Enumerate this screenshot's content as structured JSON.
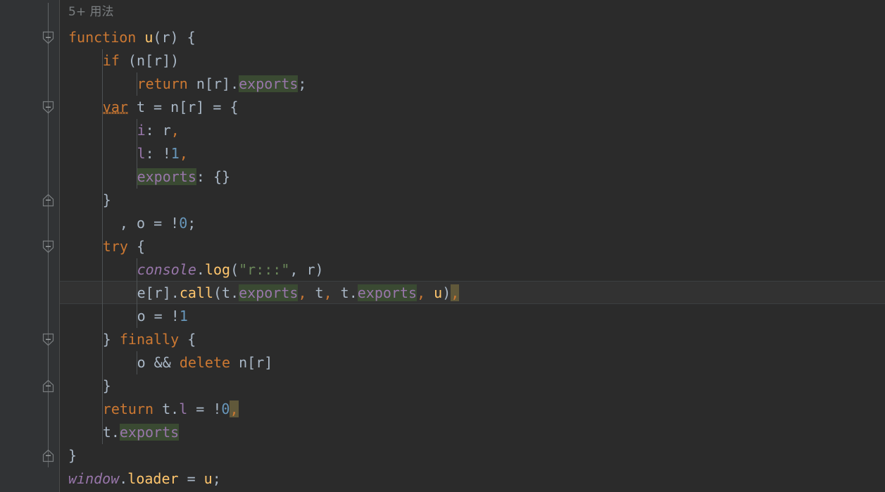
{
  "window": {
    "theme": "darcula",
    "background": "#2b2b2b",
    "gutter_background": "#313335",
    "current_line_background": "#323232",
    "accent": "#4a88c7",
    "search_highlight": "#3a4a32",
    "brace_highlight": "#60583a",
    "default_text": "#a9b7c6"
  },
  "tab_indicator": {
    "name": "active-tab-underline",
    "color": "#4a88c7"
  },
  "code_vision": {
    "label": "5+ 用法"
  },
  "gutter": {
    "fold_markers": [
      {
        "type": "expanded-down",
        "line": 1
      },
      {
        "type": "expanded-down",
        "line": 4
      },
      {
        "type": "expanded-up",
        "line": 8
      },
      {
        "type": "expanded-down",
        "line": 10
      },
      {
        "type": "expanded-down",
        "line": 14
      },
      {
        "type": "expanded-up",
        "line": 16
      },
      {
        "type": "expanded-up",
        "line": 19
      }
    ]
  },
  "editor": {
    "current_line_index": 12,
    "lines": [
      {
        "n": 0,
        "indent": 0,
        "kind": "inline-hint",
        "text": "5+ 用法"
      },
      {
        "n": 1,
        "indent": 0,
        "tokens": [
          {
            "t": "function",
            "c": "kw"
          },
          {
            "t": " ",
            "c": "plain"
          },
          {
            "t": "u",
            "c": "fnname"
          },
          {
            "t": "(",
            "c": "punct"
          },
          {
            "t": "r",
            "c": "ident"
          },
          {
            "t": ") {",
            "c": "punct"
          }
        ]
      },
      {
        "n": 2,
        "indent": 1,
        "tokens": [
          {
            "t": "if",
            "c": "kw"
          },
          {
            "t": " (",
            "c": "punct"
          },
          {
            "t": "n",
            "c": "ident"
          },
          {
            "t": "[",
            "c": "punct"
          },
          {
            "t": "r",
            "c": "ident"
          },
          {
            "t": "])",
            "c": "punct"
          }
        ]
      },
      {
        "n": 3,
        "indent": 2,
        "tokens": [
          {
            "t": "return",
            "c": "kw"
          },
          {
            "t": " ",
            "c": "plain"
          },
          {
            "t": "n",
            "c": "ident"
          },
          {
            "t": "[",
            "c": "punct"
          },
          {
            "t": "r",
            "c": "ident"
          },
          {
            "t": "].",
            "c": "punct"
          },
          {
            "t": "exports",
            "c": "prop",
            "hl": "search"
          },
          {
            "t": ";",
            "c": "punct"
          }
        ]
      },
      {
        "n": 4,
        "indent": 1,
        "tokens": [
          {
            "t": "var",
            "c": "kw",
            "squiggle": true
          },
          {
            "t": " ",
            "c": "plain"
          },
          {
            "t": "t",
            "c": "ident"
          },
          {
            "t": " = ",
            "c": "punct"
          },
          {
            "t": "n",
            "c": "ident"
          },
          {
            "t": "[",
            "c": "punct"
          },
          {
            "t": "r",
            "c": "ident"
          },
          {
            "t": "] = {",
            "c": "punct"
          }
        ]
      },
      {
        "n": 5,
        "indent": 2,
        "tokens": [
          {
            "t": "i",
            "c": "field"
          },
          {
            "t": ": ",
            "c": "punct"
          },
          {
            "t": "r",
            "c": "ident"
          },
          {
            "t": ",",
            "c": "comma"
          }
        ]
      },
      {
        "n": 6,
        "indent": 2,
        "tokens": [
          {
            "t": "l",
            "c": "field"
          },
          {
            "t": ": ",
            "c": "punct"
          },
          {
            "t": "!",
            "c": "punct"
          },
          {
            "t": "1",
            "c": "num"
          },
          {
            "t": ",",
            "c": "comma"
          }
        ]
      },
      {
        "n": 7,
        "indent": 2,
        "tokens": [
          {
            "t": "exports",
            "c": "prop",
            "hl": "search"
          },
          {
            "t": ": {}",
            "c": "punct"
          }
        ]
      },
      {
        "n": 8,
        "indent": 1,
        "tokens": [
          {
            "t": "}",
            "c": "punct"
          }
        ]
      },
      {
        "n": 9,
        "indent": 1,
        "lead": "  ",
        "tokens": [
          {
            "t": ", ",
            "c": "punct"
          },
          {
            "t": "o",
            "c": "ident"
          },
          {
            "t": " = ",
            "c": "punct"
          },
          {
            "t": "!",
            "c": "punct"
          },
          {
            "t": "0",
            "c": "num"
          },
          {
            "t": ";",
            "c": "punct"
          }
        ]
      },
      {
        "n": 10,
        "indent": 1,
        "tokens": [
          {
            "t": "try",
            "c": "kw"
          },
          {
            "t": " {",
            "c": "punct"
          }
        ]
      },
      {
        "n": 11,
        "indent": 2,
        "tokens": [
          {
            "t": "console",
            "c": "global"
          },
          {
            "t": ".",
            "c": "punct"
          },
          {
            "t": "log",
            "c": "fnname"
          },
          {
            "t": "(",
            "c": "punct"
          },
          {
            "t": "\"r:::\"",
            "c": "str"
          },
          {
            "t": ", ",
            "c": "punct"
          },
          {
            "t": "r",
            "c": "ident"
          },
          {
            "t": ")",
            "c": "punct"
          }
        ]
      },
      {
        "n": 12,
        "indent": 2,
        "current": true,
        "tokens": [
          {
            "t": "e",
            "c": "ident"
          },
          {
            "t": "[",
            "c": "punct"
          },
          {
            "t": "r",
            "c": "ident"
          },
          {
            "t": "].",
            "c": "punct"
          },
          {
            "t": "call",
            "c": "fnname"
          },
          {
            "t": "(",
            "c": "punct"
          },
          {
            "t": "t",
            "c": "ident"
          },
          {
            "t": ".",
            "c": "punct"
          },
          {
            "t": "exports",
            "c": "prop",
            "hl": "search"
          },
          {
            "t": ",",
            "c": "comma"
          },
          {
            "t": " ",
            "c": "plain"
          },
          {
            "t": "t",
            "c": "ident"
          },
          {
            "t": ",",
            "c": "comma"
          },
          {
            "t": " ",
            "c": "plain"
          },
          {
            "t": "t",
            "c": "ident"
          },
          {
            "t": ".",
            "c": "punct"
          },
          {
            "t": "exports",
            "c": "prop",
            "hl": "search"
          },
          {
            "t": ",",
            "c": "comma"
          },
          {
            "t": " ",
            "c": "plain"
          },
          {
            "t": "u",
            "c": "fnname"
          },
          {
            "t": ")",
            "c": "punct"
          },
          {
            "t": ",",
            "c": "comma",
            "hl": "brace"
          }
        ]
      },
      {
        "n": 13,
        "indent": 2,
        "tokens": [
          {
            "t": "o",
            "c": "ident"
          },
          {
            "t": " = ",
            "c": "punct"
          },
          {
            "t": "!",
            "c": "punct"
          },
          {
            "t": "1",
            "c": "num"
          }
        ]
      },
      {
        "n": 14,
        "indent": 1,
        "tokens": [
          {
            "t": "} ",
            "c": "punct"
          },
          {
            "t": "finally",
            "c": "kw"
          },
          {
            "t": " {",
            "c": "punct"
          }
        ]
      },
      {
        "n": 15,
        "indent": 2,
        "tokens": [
          {
            "t": "o",
            "c": "ident"
          },
          {
            "t": " && ",
            "c": "punct"
          },
          {
            "t": "delete",
            "c": "kw"
          },
          {
            "t": " ",
            "c": "plain"
          },
          {
            "t": "n",
            "c": "ident"
          },
          {
            "t": "[",
            "c": "punct"
          },
          {
            "t": "r",
            "c": "ident"
          },
          {
            "t": "]",
            "c": "punct"
          }
        ]
      },
      {
        "n": 16,
        "indent": 1,
        "tokens": [
          {
            "t": "}",
            "c": "punct"
          }
        ]
      },
      {
        "n": 17,
        "indent": 1,
        "tokens": [
          {
            "t": "return",
            "c": "kw"
          },
          {
            "t": " ",
            "c": "plain"
          },
          {
            "t": "t",
            "c": "ident"
          },
          {
            "t": ".",
            "c": "punct"
          },
          {
            "t": "l",
            "c": "field"
          },
          {
            "t": " = ",
            "c": "punct"
          },
          {
            "t": "!",
            "c": "punct"
          },
          {
            "t": "0",
            "c": "num"
          },
          {
            "t": ",",
            "c": "comma",
            "hl": "brace"
          }
        ]
      },
      {
        "n": 18,
        "indent": 1,
        "tokens": [
          {
            "t": "t",
            "c": "ident"
          },
          {
            "t": ".",
            "c": "punct"
          },
          {
            "t": "exports",
            "c": "prop",
            "hl": "search"
          }
        ]
      },
      {
        "n": 19,
        "indent": 0,
        "tokens": [
          {
            "t": "}",
            "c": "punct"
          }
        ]
      },
      {
        "n": 20,
        "indent": 0,
        "tokens": [
          {
            "t": "window",
            "c": "global"
          },
          {
            "t": ".",
            "c": "punct"
          },
          {
            "t": "loader",
            "c": "fnname"
          },
          {
            "t": " = ",
            "c": "punct"
          },
          {
            "t": "u",
            "c": "fnname"
          },
          {
            "t": ";",
            "c": "punct"
          }
        ]
      }
    ]
  }
}
